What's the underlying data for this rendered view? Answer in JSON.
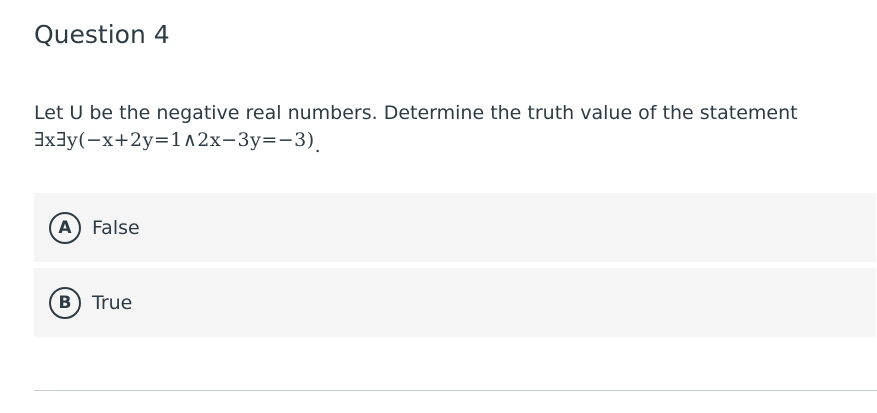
{
  "question": {
    "title": "Question 4",
    "prompt": "Let U be the negative real numbers. Determine the truth value of the statement",
    "formula": "∃x∃y(−x+2y=1∧2x−3y=−3)",
    "formula_end": "."
  },
  "choices": [
    {
      "letter": "A",
      "label": "False"
    },
    {
      "letter": "B",
      "label": "True"
    }
  ]
}
